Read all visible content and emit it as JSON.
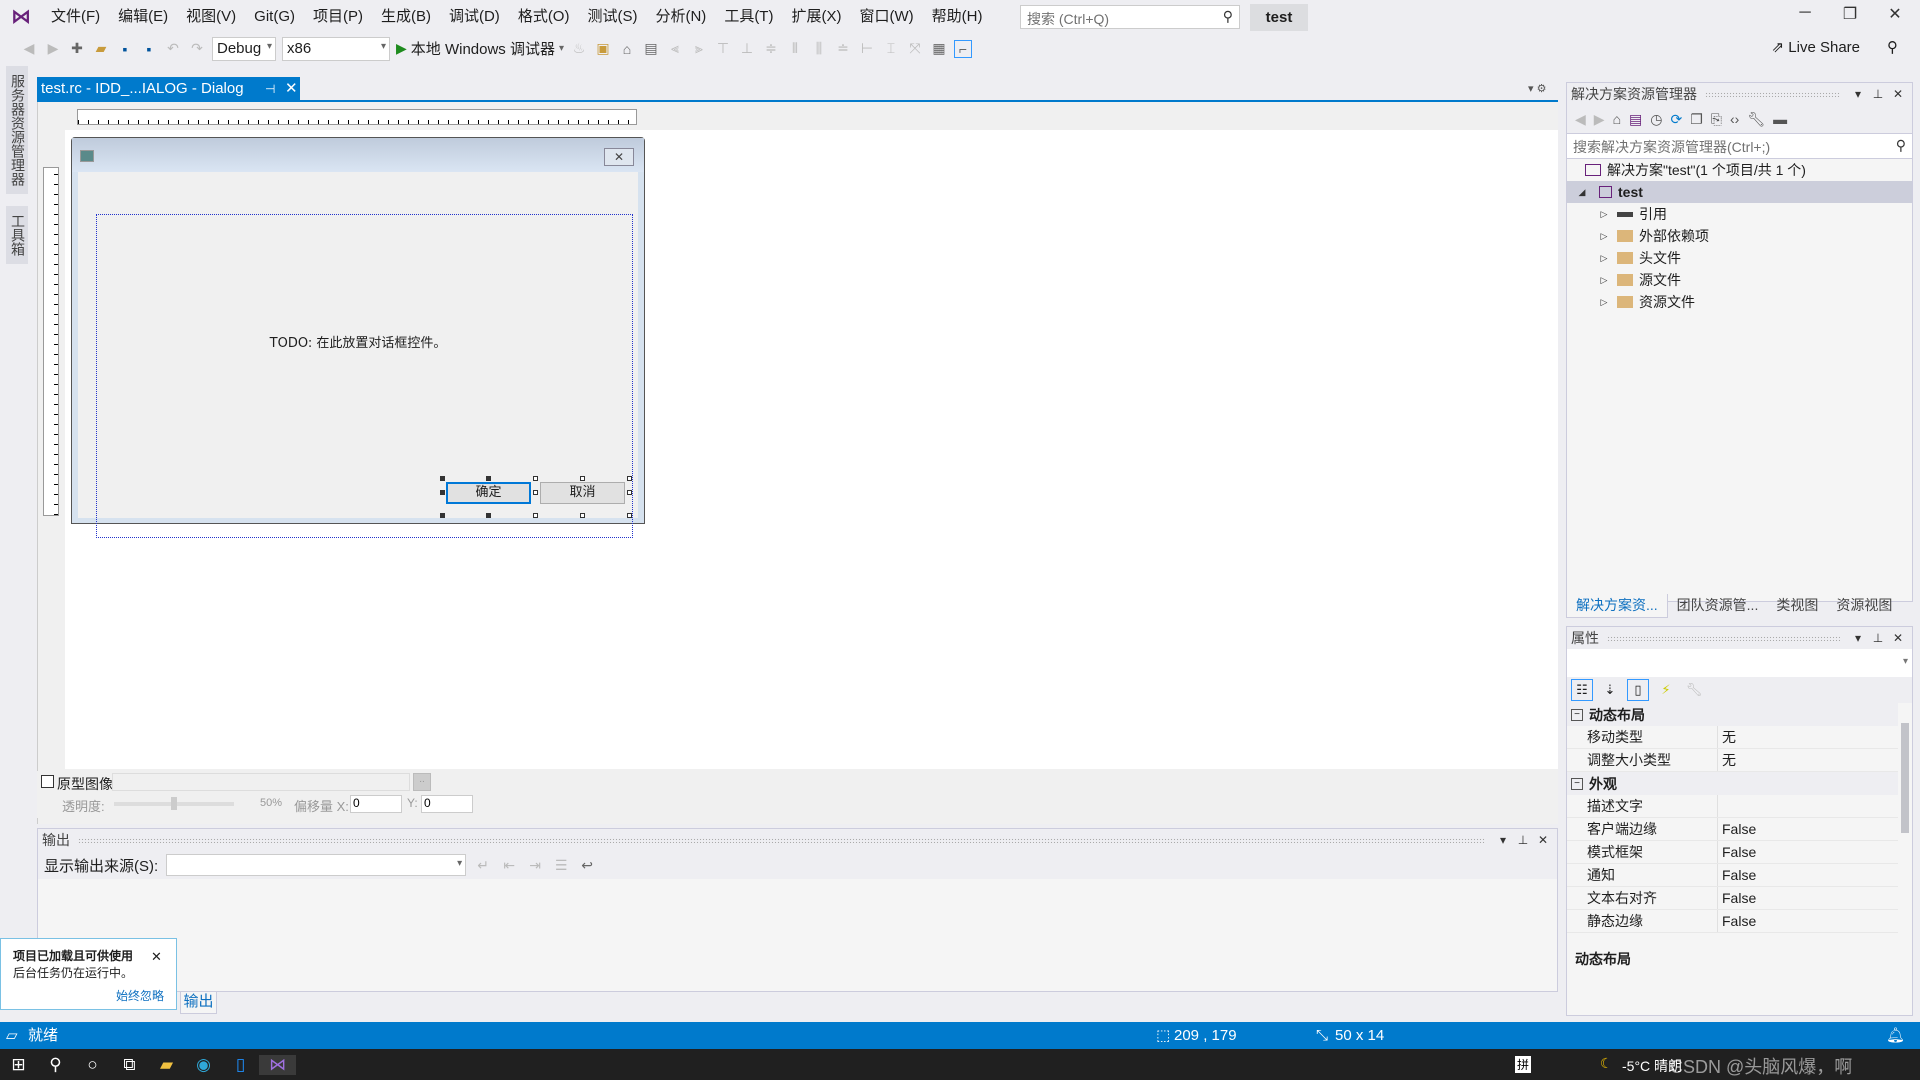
{
  "menubar": {
    "items": [
      "文件(F)",
      "编辑(E)",
      "视图(V)",
      "Git(G)",
      "项目(P)",
      "生成(B)",
      "调试(D)",
      "格式(O)",
      "测试(S)",
      "分析(N)",
      "工具(T)",
      "扩展(X)",
      "窗口(W)",
      "帮助(H)"
    ],
    "search_placeholder": "搜索 (Ctrl+Q)",
    "solution_name": "test"
  },
  "toolbar": {
    "config": "Debug",
    "platform": "x86",
    "run_label": "本地 Windows 调试器",
    "live_share": "Live Share"
  },
  "side_tabs": [
    "服务器资源管理器",
    "工具箱"
  ],
  "document": {
    "tab_title": "test.rc - IDD_...IALOG - Dialog",
    "dialog": {
      "todo_text": "TODO: 在此放置对话框控件。",
      "ok_label": "确定",
      "cancel_label": "取消"
    },
    "prototype": {
      "checkbox_label": "原型图像:",
      "browse": "..",
      "opacity_label": "透明度:",
      "opacity_value": "50%",
      "opacity_fraction": 0.5,
      "offset_label": "偏移量 X:",
      "x_value": "0",
      "y_label": "Y:",
      "y_value": "0"
    }
  },
  "output": {
    "title": "输出",
    "source_label": "显示输出来源(S):",
    "source_value": "",
    "tab_label": "输出"
  },
  "toast": {
    "title": "项目已加载且可供使用",
    "body": "后台任务仍在运行中。",
    "link": "始终忽略"
  },
  "solution_explorer": {
    "title": "解决方案资源管理器",
    "search_placeholder": "搜索解决方案资源管理器(Ctrl+;)",
    "solution_label": "解决方案\"test\"(1 个项目/共 1 个)",
    "project": "test",
    "items": [
      "引用",
      "外部依赖项",
      "头文件",
      "源文件",
      "资源文件"
    ],
    "tabs": [
      "解决方案资...",
      "团队资源管...",
      "类视图",
      "资源视图"
    ]
  },
  "properties": {
    "title": "属性",
    "categories": [
      {
        "name": "动态布局",
        "rows": [
          {
            "name": "移动类型",
            "value": "无"
          },
          {
            "name": "调整大小类型",
            "value": "无"
          }
        ]
      },
      {
        "name": "外观",
        "rows": [
          {
            "name": "描述文字",
            "value": ""
          },
          {
            "name": "客户端边缘",
            "value": "False"
          },
          {
            "name": "模式框架",
            "value": "False"
          },
          {
            "name": "通知",
            "value": "False"
          },
          {
            "name": "文本右对齐",
            "value": "False"
          },
          {
            "name": "静态边缘",
            "value": "False"
          }
        ]
      }
    ],
    "description_title": "动态布局"
  },
  "status": {
    "ready": "就绪",
    "position": "209 , 179",
    "size": "50 x 14"
  },
  "taskbar": {
    "weather": "-5°C 晴朗",
    "ime": "拼",
    "watermark": "CSDN @头脑风爆，啊"
  },
  "colors": {
    "accent": "#007acc",
    "vs_purple": "#68217a"
  }
}
